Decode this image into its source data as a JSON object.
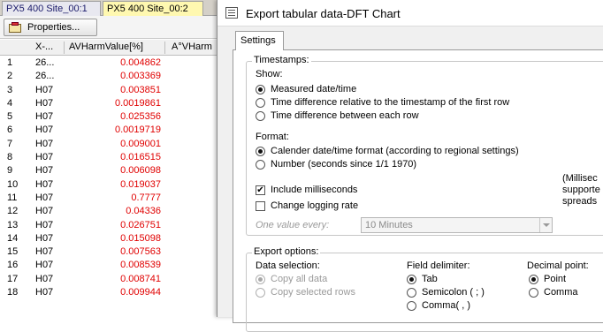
{
  "background_window": {
    "tabs": [
      "PX5 400 Site_00:1",
      "PX5 400 Site_00:2"
    ],
    "properties_label": "Properties...",
    "columns": [
      "X-...",
      "AVHarmValue[%]",
      "A°VHarm"
    ],
    "rows": [
      {
        "idx": "1",
        "x": "26...",
        "value": "0.004862"
      },
      {
        "idx": "2",
        "x": "26...",
        "value": "0.003369"
      },
      {
        "idx": "3",
        "x": "H07",
        "value": "0.003851"
      },
      {
        "idx": "4",
        "x": "H07",
        "value": "0.0019861"
      },
      {
        "idx": "5",
        "x": "H07",
        "value": "0.025356"
      },
      {
        "idx": "6",
        "x": "H07",
        "value": "0.0019719"
      },
      {
        "idx": "7",
        "x": "H07",
        "value": "0.009001"
      },
      {
        "idx": "8",
        "x": "H07",
        "value": "0.016515"
      },
      {
        "idx": "9",
        "x": "H07",
        "value": "0.006098"
      },
      {
        "idx": "10",
        "x": "H07",
        "value": "0.019037"
      },
      {
        "idx": "11",
        "x": "H07",
        "value": "0.7777"
      },
      {
        "idx": "12",
        "x": "H07",
        "value": "0.04336"
      },
      {
        "idx": "13",
        "x": "H07",
        "value": "0.026751"
      },
      {
        "idx": "14",
        "x": "H07",
        "value": "0.015098"
      },
      {
        "idx": "15",
        "x": "H07",
        "value": "0.007563"
      },
      {
        "idx": "16",
        "x": "H07",
        "value": "0.008539"
      },
      {
        "idx": "17",
        "x": "H07",
        "value": "0.008741"
      },
      {
        "idx": "18",
        "x": "H07",
        "value": "0.009944"
      }
    ]
  },
  "dialog": {
    "title": "Export tabular data-DFT Chart",
    "tab": "Settings",
    "timestamps": {
      "title": "Timestamps:",
      "show_label": "Show:",
      "show_options": [
        "Measured date/time",
        "Time difference relative to the timestamp of the first row",
        "Time difference between each row"
      ],
      "show_selected": 0,
      "format_label": "Format:",
      "format_options": [
        "Calender date/time format (according to regional settings)",
        "Number (seconds since 1/1 1970)"
      ],
      "format_selected": 0,
      "include_ms": "Include milliseconds",
      "include_ms_checked": true,
      "change_rate": "Change logging rate",
      "change_rate_checked": false,
      "one_value_label": "One value every:",
      "one_value_value": "10 Minutes",
      "note_lines": [
        "(Millisec",
        "supporte",
        "spreads"
      ]
    },
    "export_options": {
      "title": "Export options:",
      "data_selection_label": "Data selection:",
      "data_selection_options": [
        "Copy all data",
        "Copy selected rows"
      ],
      "field_delimiter_label": "Field delimiter:",
      "field_delimiter_options": [
        "Tab",
        "Semicolon ( ; )",
        "Comma( , )"
      ],
      "decimal_point_label": "Decimal point:",
      "decimal_point_options": [
        "Point",
        "Comma"
      ]
    }
  }
}
